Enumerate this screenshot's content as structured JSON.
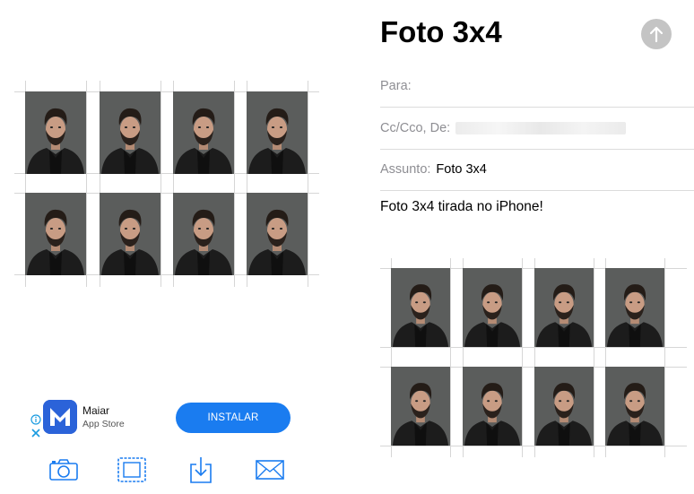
{
  "ad": {
    "app_name": "Maiar",
    "store": "App Store",
    "install_label": "INSTALAR",
    "brand_color": "#2b63d9",
    "button_color": "#1a7cf0"
  },
  "toolbar": {
    "icons": [
      "camera-icon",
      "photo-frame-icon",
      "download-icon",
      "mail-icon"
    ],
    "icon_color": "#1a7cf0"
  },
  "compose": {
    "title": "Foto 3x4",
    "to_label": "Para:",
    "cc_label": "Cc/Cco, De:",
    "subject_label": "Assunto:",
    "subject_value": "Foto 3x4",
    "body": "Foto 3x4 tirada no iPhone!",
    "send_icon": "arrow-up-icon"
  },
  "photo_sheet": {
    "rows": 2,
    "columns": 4,
    "photo_count": 8
  }
}
